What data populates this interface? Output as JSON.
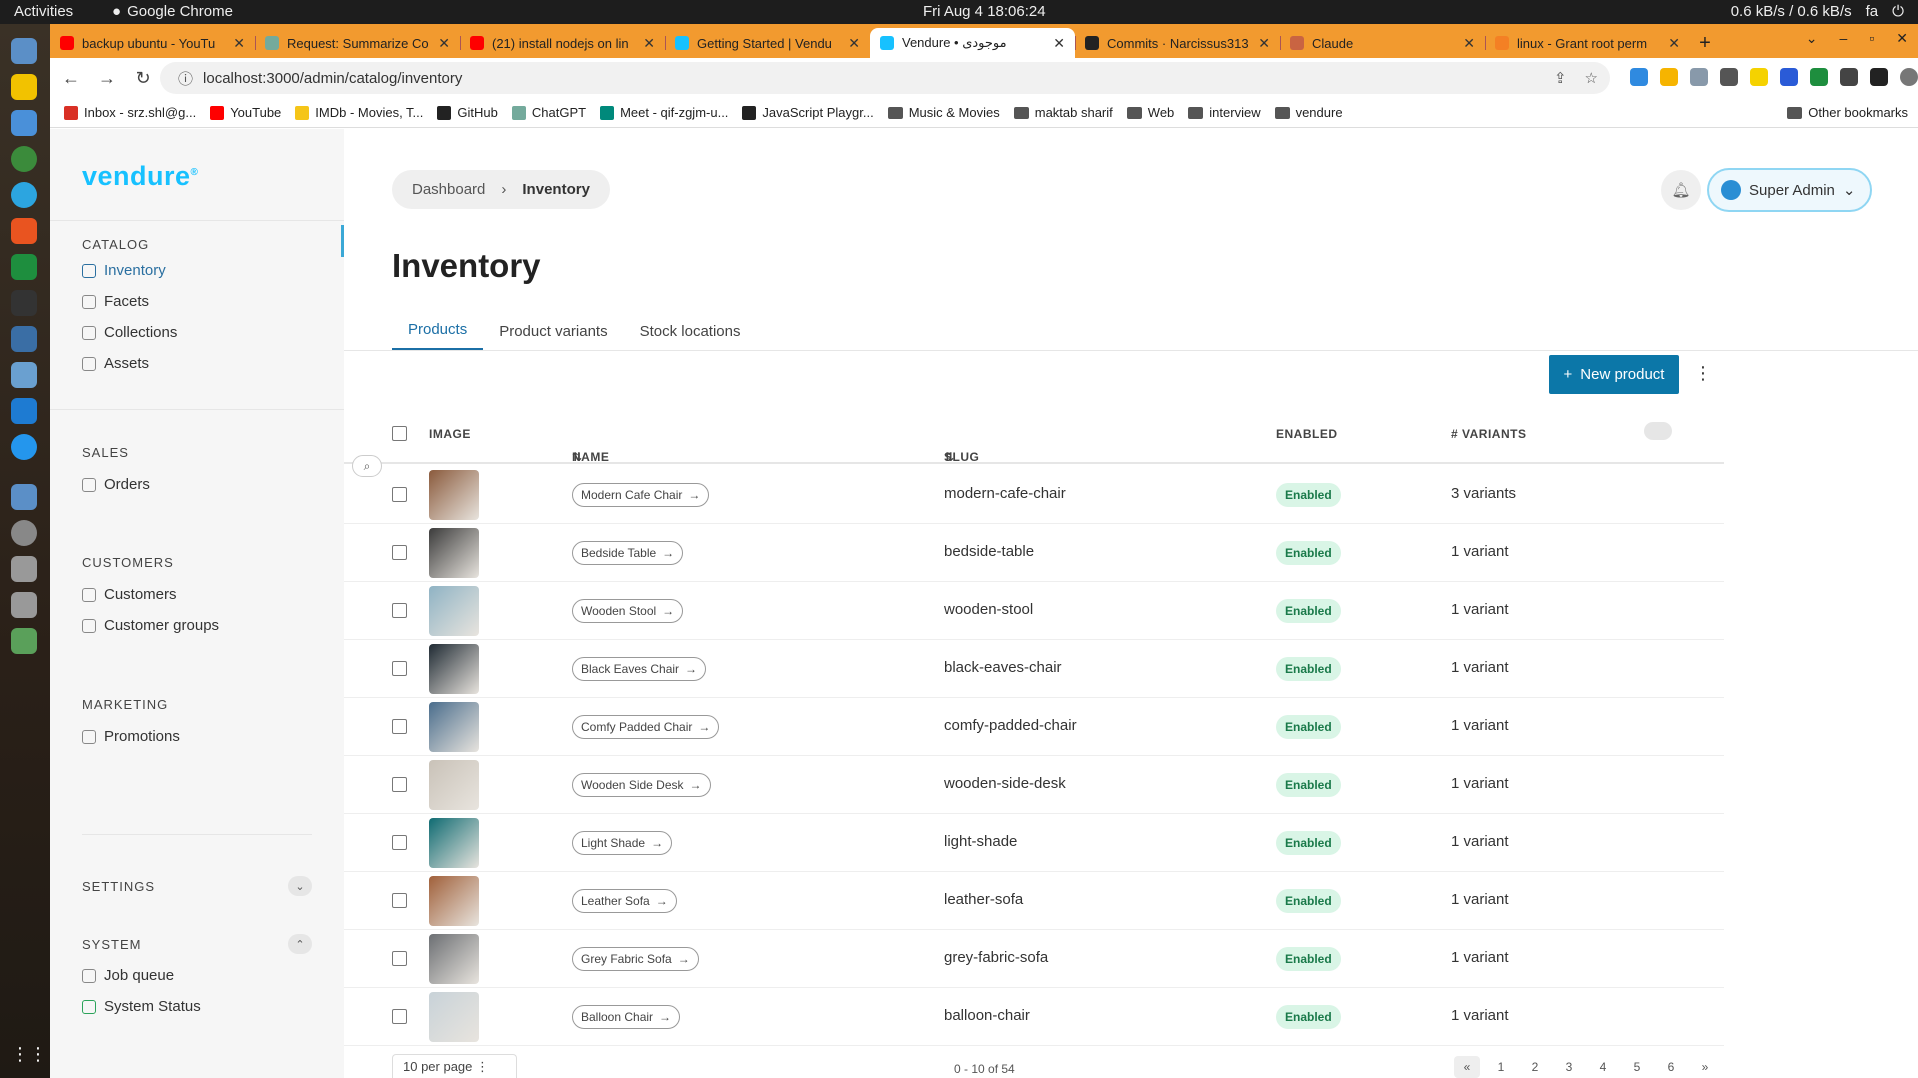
{
  "os": {
    "activities": "Activities",
    "app_name": "Google Chrome",
    "clock": "Fri Aug 4  18:06:24",
    "net_speed": "0.6 kB/s / 0.6 kB/s",
    "lang": "fa"
  },
  "browser": {
    "tabs": [
      {
        "title": "backup ubuntu - YouTu",
        "color": "#ff0000"
      },
      {
        "title": "Request: Summarize Co",
        "color": "#74aa9c"
      },
      {
        "title": "(21) install nodejs on lin",
        "color": "#ff0000"
      },
      {
        "title": "Getting Started | Vendu",
        "color": "#17c1ff"
      },
      {
        "title": "Vendure • موجودی",
        "color": "#17c1ff",
        "active": true
      },
      {
        "title": "Commits · Narcissus313",
        "color": "#222222"
      },
      {
        "title": "Claude",
        "color": "#c96442"
      },
      {
        "title": "linux - Grant root perm",
        "color": "#f48024"
      }
    ],
    "url": "localhost:3000/admin/catalog/inventory",
    "bookmarks": [
      {
        "label": "Inbox - srz.shl@g...",
        "color": "#d93025",
        "folder": false
      },
      {
        "label": "YouTube",
        "color": "#ff0000",
        "folder": false
      },
      {
        "label": "IMDb - Movies, T...",
        "color": "#f5c518",
        "folder": false
      },
      {
        "label": "GitHub",
        "color": "#222222",
        "folder": false
      },
      {
        "label": "ChatGPT",
        "color": "#74aa9c",
        "folder": false
      },
      {
        "label": "Meet - qif-zgjm-u...",
        "color": "#00897b",
        "folder": false
      },
      {
        "label": "JavaScript Playgr...",
        "color": "#222222",
        "folder": false
      },
      {
        "label": "Music & Movies",
        "folder": true
      },
      {
        "label": "maktab sharif",
        "folder": true
      },
      {
        "label": "Web",
        "folder": true
      },
      {
        "label": "interview",
        "folder": true
      },
      {
        "label": "vendure",
        "folder": true
      }
    ],
    "other_bookmarks": "Other bookmarks"
  },
  "sidebar": {
    "logo": "vendure",
    "sections": {
      "catalog": "CATALOG",
      "sales": "SALES",
      "customers": "CUSTOMERS",
      "marketing": "MARKETING",
      "settings": "SETTINGS",
      "system": "SYSTEM"
    },
    "items": {
      "inventory": "Inventory",
      "facets": "Facets",
      "collections": "Collections",
      "assets": "Assets",
      "orders": "Orders",
      "customers": "Customers",
      "customer_groups": "Customer groups",
      "promotions": "Promotions",
      "job_queue": "Job queue",
      "system_status": "System Status"
    }
  },
  "header": {
    "breadcrumb": [
      "Dashboard",
      "Inventory"
    ],
    "user": "Super Admin"
  },
  "page": {
    "title": "Inventory",
    "tabs": [
      "Products",
      "Product variants",
      "Stock locations"
    ],
    "new_product": "New product"
  },
  "table": {
    "headers": {
      "image": "IMAGE",
      "name": "NAME",
      "slug": "SLUG",
      "enabled": "ENABLED",
      "variants": "# VARIANTS"
    },
    "rows": [
      {
        "name": "Modern Cafe Chair",
        "slug": "modern-cafe-chair",
        "status": "Enabled",
        "variants": "3 variants",
        "thumb": "#8a5a3c"
      },
      {
        "name": "Bedside Table",
        "slug": "bedside-table",
        "status": "Enabled",
        "variants": "1 variant",
        "thumb": "#3b3b3b"
      },
      {
        "name": "Wooden Stool",
        "slug": "wooden-stool",
        "status": "Enabled",
        "variants": "1 variant",
        "thumb": "#8fb3c4"
      },
      {
        "name": "Black Eaves Chair",
        "slug": "black-eaves-chair",
        "status": "Enabled",
        "variants": "1 variant",
        "thumb": "#1f2a33"
      },
      {
        "name": "Comfy Padded Chair",
        "slug": "comfy-padded-chair",
        "status": "Enabled",
        "variants": "1 variant",
        "thumb": "#4a6d8c"
      },
      {
        "name": "Wooden Side Desk",
        "slug": "wooden-side-desk",
        "status": "Enabled",
        "variants": "1 variant",
        "thumb": "#c9c2b8"
      },
      {
        "name": "Light Shade",
        "slug": "light-shade",
        "status": "Enabled",
        "variants": "1 variant",
        "thumb": "#0f6b72"
      },
      {
        "name": "Leather Sofa",
        "slug": "leather-sofa",
        "status": "Enabled",
        "variants": "1 variant",
        "thumb": "#a0603a"
      },
      {
        "name": "Grey Fabric Sofa",
        "slug": "grey-fabric-sofa",
        "status": "Enabled",
        "variants": "1 variant",
        "thumb": "#6c6f73"
      },
      {
        "name": "Balloon Chair",
        "slug": "balloon-chair",
        "status": "Enabled",
        "variants": "1 variant",
        "thumb": "#c8d2d8"
      }
    ]
  },
  "footer": {
    "per_page": "10 per page",
    "range": "0 - 10 of 54",
    "pages": [
      "«",
      "1",
      "2",
      "3",
      "4",
      "5",
      "6",
      "»"
    ]
  }
}
